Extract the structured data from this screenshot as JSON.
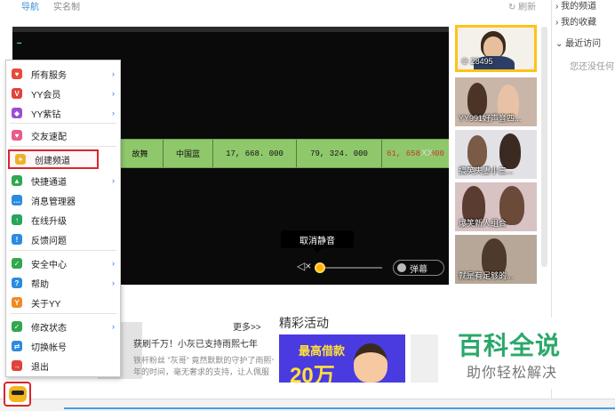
{
  "topbar": {
    "nav": "导航",
    "realname": "实名制",
    "refresh": "刷新"
  },
  "rightcol": {
    "items": [
      "我的频道",
      "我的收藏",
      "最近访问"
    ],
    "note": "您还没任何"
  },
  "video": {
    "table_row": [
      "故舞",
      "中国蓝",
      "17, 668. 000",
      "79, 324. 000",
      "61, 658. 000"
    ],
    "tag": "XX",
    "tooltip": "取消静音",
    "danmu": "弹幕",
    "volume_level": 0.1
  },
  "thumbnails": [
    {
      "caption": "28495",
      "icon": "user-icon"
    },
    {
      "caption": "YY991好声音四..."
    },
    {
      "caption": "搞笑夫妻小三..."
    },
    {
      "caption": "爆笑新人组合"
    },
    {
      "caption": "就是有足够的..."
    }
  ],
  "news": {
    "more": "更多>>",
    "line1": "获刷千万！小灰已支持雨熙七年",
    "line2": "铁杆粉丝 \"灰哥\" 竟然默默的守护了雨熙七",
    "line3": "年的时间，毫无奢求的支持，让人佩服"
  },
  "activity": {
    "title": "精彩活动",
    "banner_line1": "最高借款",
    "banner_line2": "20万"
  },
  "watermark": {
    "title": "百科全说",
    "subtitle": "助你轻松解决"
  },
  "menu": {
    "items": [
      {
        "label": "所有服务",
        "icon": "heart-icon",
        "color": "#e84a3c",
        "arrow": true
      },
      {
        "label": "YY会员",
        "icon": "vip-icon",
        "color": "#e0433a",
        "arrow": true
      },
      {
        "label": "YY紫钻",
        "icon": "diamond-icon",
        "color": "#9b4bd6",
        "arrow": true
      },
      {
        "label": "交友速配",
        "icon": "heart-match-icon",
        "color": "#e85b8a",
        "arrow": false
      },
      {
        "label": "创建频道",
        "icon": "create-channel-icon",
        "color": "#f0b12a",
        "arrow": false,
        "highlight": true
      },
      {
        "label": "快捷通道",
        "icon": "shortcut-icon",
        "color": "#2fa84f",
        "arrow": true
      },
      {
        "label": "消息管理器",
        "icon": "message-icon",
        "color": "#2c8be0",
        "arrow": false
      },
      {
        "label": "在线升级",
        "icon": "upgrade-icon",
        "color": "#26a65b",
        "arrow": false
      },
      {
        "label": "反馈问题",
        "icon": "feedback-icon",
        "color": "#2c8be0",
        "arrow": false
      },
      {
        "label": "安全中心",
        "icon": "shield-icon",
        "color": "#2fa84f",
        "arrow": true
      },
      {
        "label": "帮助",
        "icon": "help-icon",
        "color": "#2c8be0",
        "arrow": true
      },
      {
        "label": "关于YY",
        "icon": "about-icon",
        "color": "#f08a24",
        "arrow": false
      },
      {
        "label": "修改状态",
        "icon": "status-icon",
        "color": "#2fa84f",
        "arrow": true
      },
      {
        "label": "切换帐号",
        "icon": "switch-icon",
        "color": "#2c8be0",
        "arrow": false
      },
      {
        "label": "退出",
        "icon": "exit-icon",
        "color": "#e0433a",
        "arrow": false
      }
    ]
  }
}
